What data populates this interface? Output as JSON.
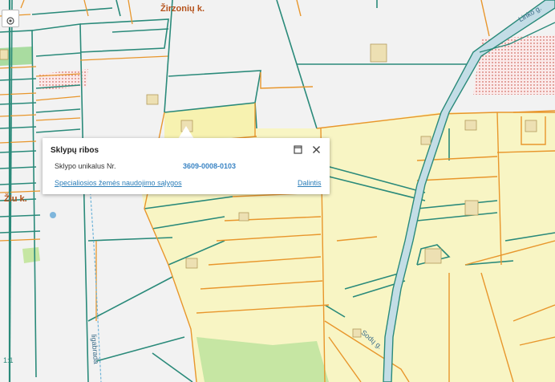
{
  "map": {
    "labels": {
      "street_top": "Žirzonių k.",
      "village_left": "Žiu k.",
      "road_top_right": "Linko g.",
      "road_bottom": "Sodų g.",
      "road_bottom_left": "ligabrada",
      "corner_tag": "1:1"
    },
    "colors": {
      "parcel_fill": "#f8f5c4",
      "parcel_border_orange": "#e8962c",
      "parcel_border_teal": "#2a8a7a",
      "forest_green": "#c6e6a3",
      "background": "#f2f2f2"
    }
  },
  "controls": {
    "locate_icon": "locate-icon"
  },
  "popup": {
    "title": "Sklypų ribos",
    "field_label": "Sklypo unikalus Nr.",
    "field_value": "3609-0008-0103",
    "link_conditions": "Specialiosios žemės naudojimo sąlygos",
    "link_share": "Dalintis",
    "maximize_icon": "maximize-icon",
    "close_icon": "close-icon"
  }
}
